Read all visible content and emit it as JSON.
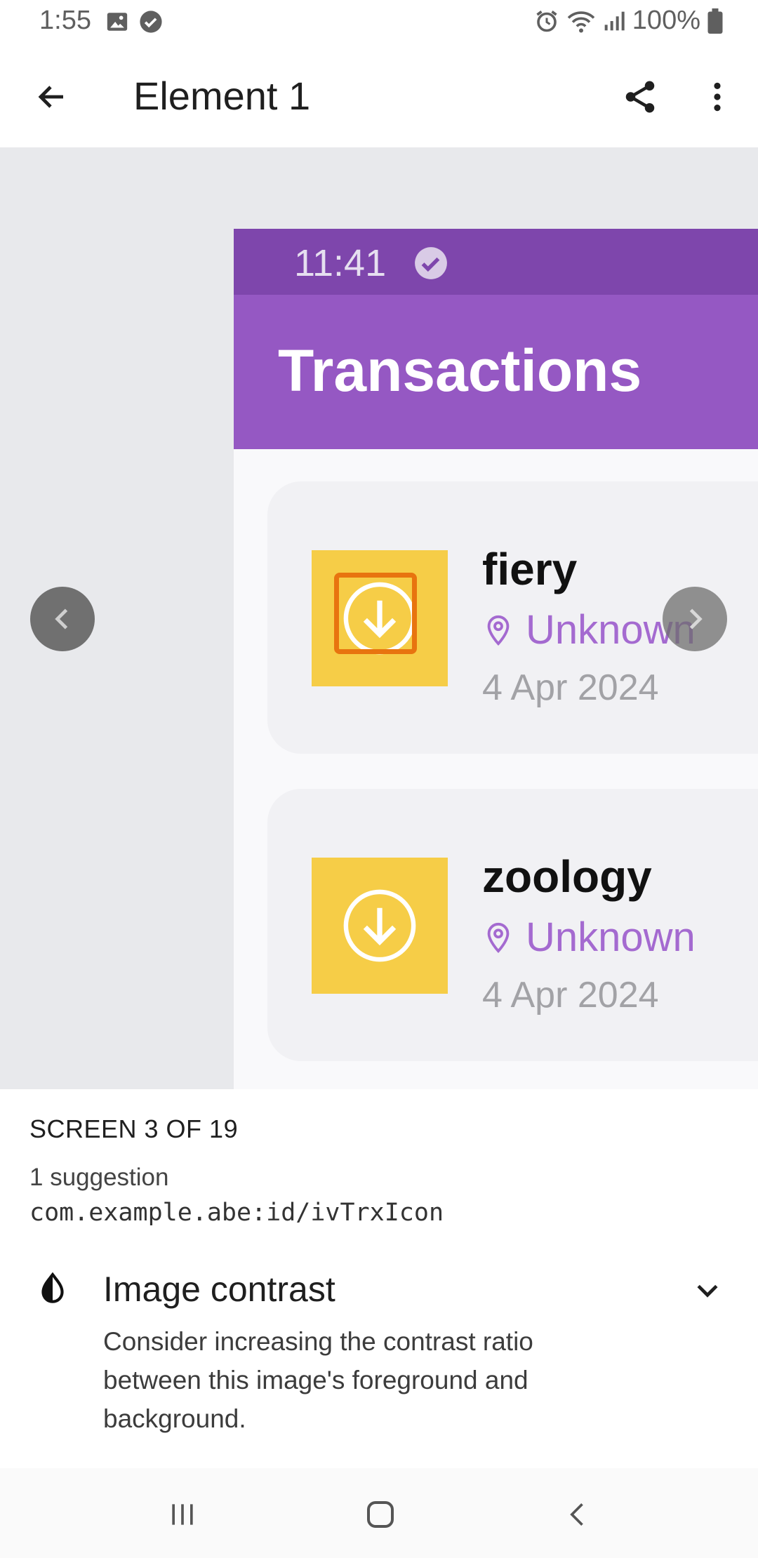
{
  "status_bar": {
    "time": "1:55",
    "battery": "100%"
  },
  "app_bar": {
    "title": "Element 1",
    "back_icon": "arrow-left-icon",
    "share_icon": "share-icon",
    "more_icon": "more-vert-icon"
  },
  "preview": {
    "phone_time": "11:41",
    "screen_title": "Transactions",
    "transactions": [
      {
        "name": "fiery",
        "location": "Unknown",
        "date": "4 Apr 2024"
      },
      {
        "name": "zoology",
        "location": "Unknown",
        "date": "4 Apr 2024"
      }
    ],
    "colors": {
      "status": "#7e46ac",
      "toolbar": "#9558c3",
      "icon_bg": "#f6cd47",
      "location": "#a46ad0",
      "highlight": "#e8740f"
    }
  },
  "sheet": {
    "screen_count": "SCREEN 3 OF 19",
    "suggestion_count": "1 suggestion",
    "resource_id": "com.example.abe:id/ivTrxIcon",
    "issue": {
      "title": "Image contrast",
      "description": "Consider increasing the contrast ratio between this image's foreground and background."
    }
  }
}
